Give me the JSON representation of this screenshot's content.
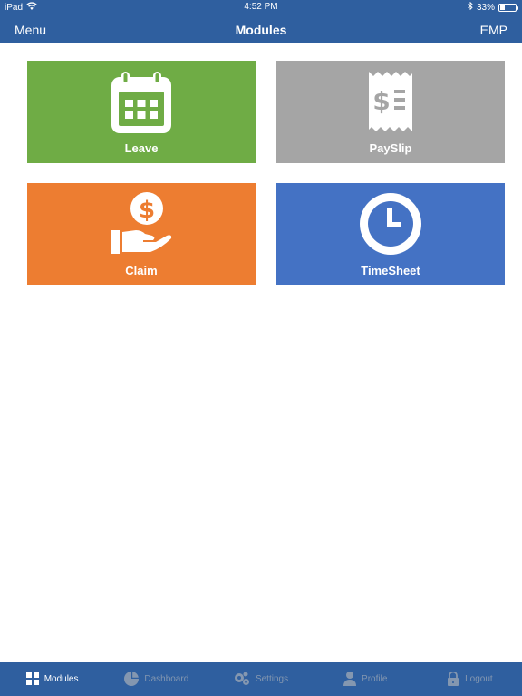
{
  "status_bar": {
    "device": "iPad",
    "time": "4:52 PM",
    "battery": "33%",
    "battery_level": 0.33
  },
  "nav": {
    "left": "Menu",
    "title": "Modules",
    "right": "EMP"
  },
  "tiles": [
    {
      "label": "Leave",
      "color": "#6fac45",
      "icon": "calendar-icon"
    },
    {
      "label": "PaySlip",
      "color": "#a5a5a5",
      "icon": "receipt-icon"
    },
    {
      "label": "Claim",
      "color": "#ed7d31",
      "icon": "hand-dollar-icon"
    },
    {
      "label": "TimeSheet",
      "color": "#4472c4",
      "icon": "clock-icon"
    }
  ],
  "tabbar": {
    "color": "#2f5f9f",
    "active_color": "#ffffff",
    "inactive_color": "#8497b0",
    "items": [
      {
        "label": "Modules",
        "icon": "grid-icon",
        "active": true
      },
      {
        "label": "Dashboard",
        "icon": "pie-chart-icon",
        "active": false
      },
      {
        "label": "Settings",
        "icon": "gears-icon",
        "active": false
      },
      {
        "label": "Profile",
        "icon": "user-icon",
        "active": false
      },
      {
        "label": "Logout",
        "icon": "lock-icon",
        "active": false
      }
    ]
  }
}
